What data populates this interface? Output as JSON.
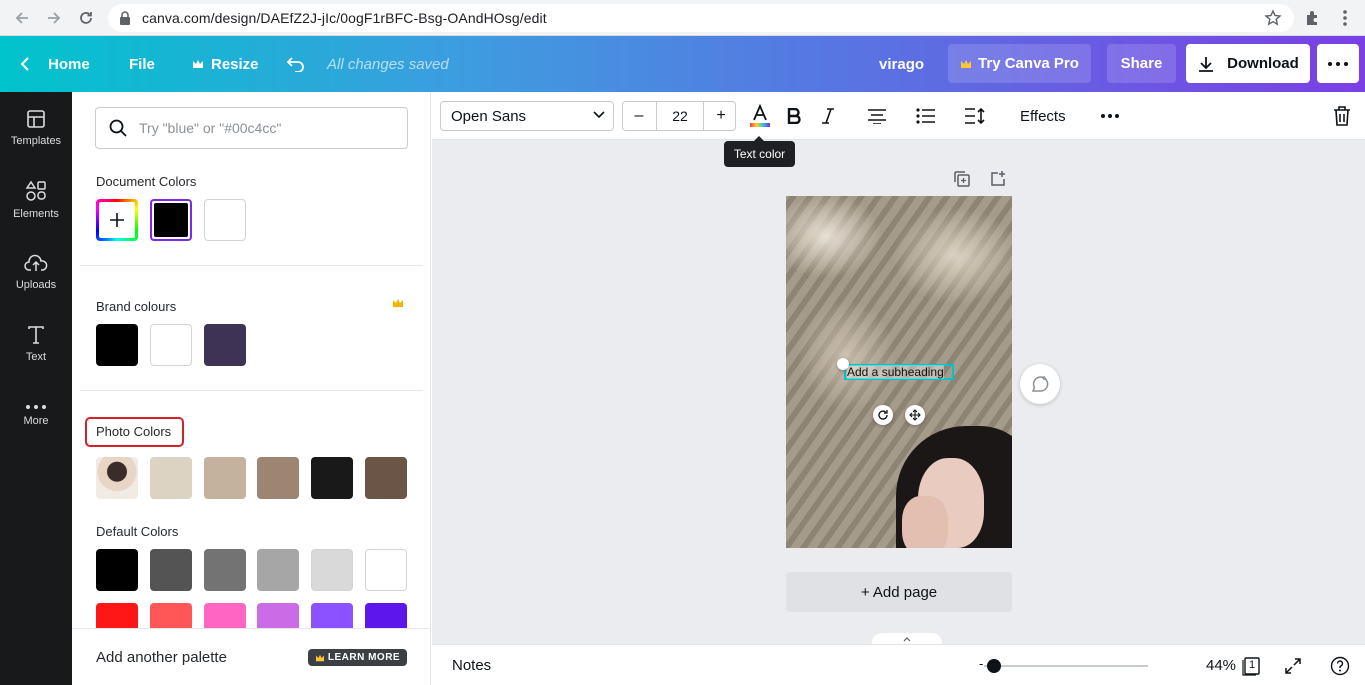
{
  "browser": {
    "url": "canva.com/design/DAEfZ2J-jIc/0ogF1rBFC-Bsg-OAndHOsg/edit"
  },
  "topbar": {
    "home": "Home",
    "file": "File",
    "resize": "Resize",
    "saved_status": "All changes saved",
    "design_name": "virago",
    "try_pro": "Try Canva Pro",
    "share": "Share",
    "download": "Download"
  },
  "rail": {
    "items": [
      {
        "label": "Templates",
        "icon": "templates-icon"
      },
      {
        "label": "Elements",
        "icon": "elements-icon"
      },
      {
        "label": "Uploads",
        "icon": "uploads-icon"
      },
      {
        "label": "Text",
        "icon": "text-icon"
      },
      {
        "label": "More",
        "icon": "more-icon"
      }
    ]
  },
  "panel": {
    "search_placeholder": "Try \"blue\" or \"#00c4cc\"",
    "document_colors": {
      "title": "Document Colors",
      "colors": [
        "#000000",
        "#ffffff"
      ]
    },
    "brand_colours": {
      "title": "Brand colours",
      "colors": [
        "#000000",
        "#ffffff",
        "#3e3354"
      ]
    },
    "photo_colors": {
      "title": "Photo Colors",
      "colors": [
        "#ddd3c3",
        "#c4b29e",
        "#9d8571",
        "#1a1919",
        "#6b5547"
      ]
    },
    "default_colors": {
      "title": "Default Colors",
      "row1": [
        "#000000",
        "#545454",
        "#737373",
        "#a6a6a6",
        "#d9d9d9",
        "#ffffff"
      ],
      "row2": [
        "#ff1616",
        "#ff5757",
        "#ff66c4",
        "#cb6ce6",
        "#8c52ff",
        "#5e17eb"
      ]
    },
    "add_palette": "Add another palette",
    "learn_more": "LEARN MORE"
  },
  "toolbar": {
    "font": "Open Sans",
    "font_size": "22",
    "effects": "Effects",
    "tooltip": "Text color"
  },
  "canvas": {
    "text_element": "Add a subheading",
    "add_page": "+ Add page"
  },
  "footer": {
    "notes": "Notes",
    "zoom": "44%",
    "page_count": "1"
  },
  "colors": {
    "accent": "#00c4cc",
    "purple": "#7b3fe4",
    "highlight": "#d0242b"
  }
}
